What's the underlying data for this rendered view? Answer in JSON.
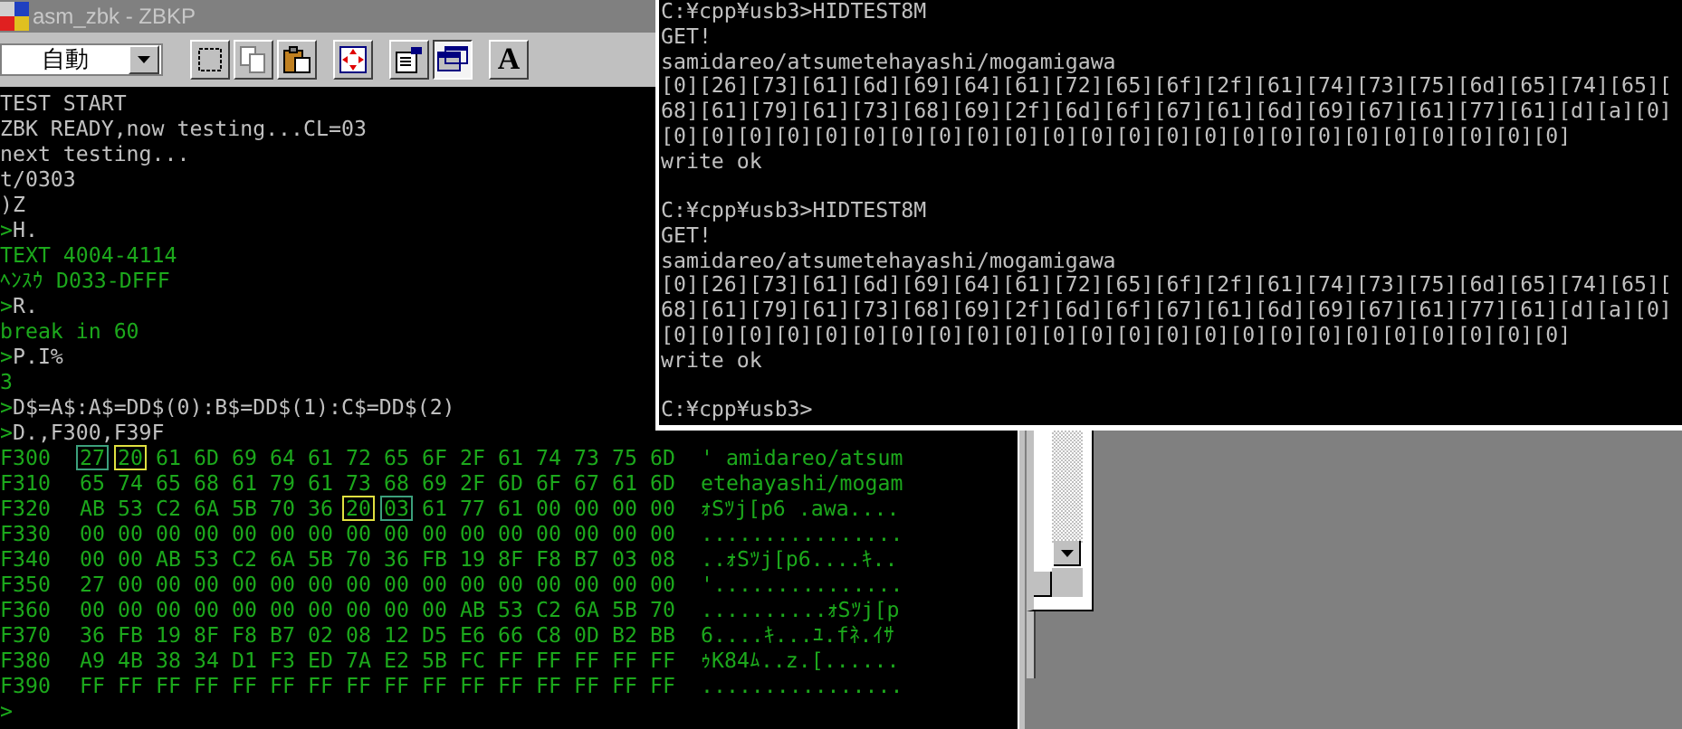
{
  "left_window": {
    "title": "asm_zbk - ZBKP",
    "toolbar": {
      "dropdown": {
        "value": "自動"
      },
      "buttons": [
        {
          "kind": "select",
          "pressed": false
        },
        {
          "kind": "copy",
          "pressed": false
        },
        {
          "kind": "paste",
          "pressed": false
        },
        {
          "kind": "fullscreen",
          "pressed": false
        },
        {
          "kind": "properties",
          "pressed": false
        },
        {
          "kind": "background",
          "pressed": true
        },
        {
          "kind": "font",
          "label": "A",
          "pressed": false
        }
      ]
    },
    "terminal": {
      "lines": [
        {
          "kind": "text",
          "text": "TEST START"
        },
        {
          "kind": "text",
          "text": "ZBK READY,now testing...CL=03"
        },
        {
          "kind": "text",
          "text": "next testing..."
        },
        {
          "kind": "text",
          "text": "t/0303"
        },
        {
          "kind": "text",
          "text": ")Z"
        },
        {
          "kind": "command",
          "prompt": ">",
          "text": "H."
        },
        {
          "kind": "output",
          "text": "TEXT 4004-4114"
        },
        {
          "kind": "output",
          "text": "ﾍﾝｽｳ D033-DFFF"
        },
        {
          "kind": "command",
          "prompt": ">",
          "text": "R."
        },
        {
          "kind": "output",
          "text": "break in 60"
        },
        {
          "kind": "command",
          "prompt": ">",
          "text": "P.I%"
        },
        {
          "kind": "output",
          "text": "3"
        },
        {
          "kind": "command",
          "prompt": ">",
          "text": "D$=A$:A$=DD$(0):B$=DD$(1):C$=DD$(2)"
        },
        {
          "kind": "command",
          "prompt": ">",
          "text": "D.,F300,F39F"
        }
      ],
      "dump": [
        {
          "address": "F300",
          "bytes": [
            {
              "text": "27",
              "color": "#3ca07c"
            },
            {
              "text": "20",
              "color": "#e0e040"
            },
            "61",
            "6D",
            "69",
            "64",
            "61",
            "72",
            "65",
            "6F",
            "2F",
            "61",
            "74",
            "73",
            "75",
            "6D"
          ],
          "ascii": "' amidareo/atsum"
        },
        {
          "address": "F310",
          "bytes": [
            "65",
            "74",
            "65",
            "68",
            "61",
            "79",
            "61",
            "73",
            "68",
            "69",
            "2F",
            "6D",
            "6F",
            "67",
            "61",
            "6D"
          ],
          "ascii": "etehayashi/mogam"
        },
        {
          "address": "F320",
          "bytes": [
            "AB",
            "53",
            "C2",
            "6A",
            "5B",
            "70",
            "36",
            {
              "text": "20",
              "color": "#e0e040"
            },
            {
              "text": "03",
              "color": "#3ca07c"
            },
            "61",
            "77",
            "61",
            "00",
            "00",
            "00",
            "00"
          ],
          "ascii": "ｫSﾂj[p6 .awa...."
        },
        {
          "address": "F330",
          "bytes": [
            "00",
            "00",
            "00",
            "00",
            "00",
            "00",
            "00",
            "00",
            "00",
            "00",
            "00",
            "00",
            "00",
            "00",
            "00",
            "00"
          ],
          "ascii": "................"
        },
        {
          "address": "F340",
          "bytes": [
            "00",
            "00",
            "AB",
            "53",
            "C2",
            "6A",
            "5B",
            "70",
            "36",
            "FB",
            "19",
            "8F",
            "F8",
            "B7",
            "03",
            "08"
          ],
          "ascii": "..ｫSﾂj[p6....ｷ.."
        },
        {
          "address": "F350",
          "bytes": [
            "27",
            "00",
            "00",
            "00",
            "00",
            "00",
            "00",
            "00",
            "00",
            "00",
            "00",
            "00",
            "00",
            "00",
            "00",
            "00"
          ],
          "ascii": "'..............."
        },
        {
          "address": "F360",
          "bytes": [
            "00",
            "00",
            "00",
            "00",
            "00",
            "00",
            "00",
            "00",
            "00",
            "00",
            "AB",
            "53",
            "C2",
            "6A",
            "5B",
            "70"
          ],
          "ascii": "..........ｫSﾂj[p"
        },
        {
          "address": "F370",
          "bytes": [
            "36",
            "FB",
            "19",
            "8F",
            "F8",
            "B7",
            "02",
            "08",
            "12",
            "D5",
            "E6",
            "66",
            "C8",
            "0D",
            "B2",
            "BB"
          ],
          "ascii": "6....ｷ...ﾕ.fﾈ.ｲｻ"
        },
        {
          "address": "F380",
          "bytes": [
            "A9",
            "4B",
            "38",
            "34",
            "D1",
            "F3",
            "ED",
            "7A",
            "E2",
            "5B",
            "FC",
            "FF",
            "FF",
            "FF",
            "FF",
            "FF"
          ],
          "ascii": "ｩK84ﾑ..z.[......"
        },
        {
          "address": "F390",
          "bytes": [
            "FF",
            "FF",
            "FF",
            "FF",
            "FF",
            "FF",
            "FF",
            "FF",
            "FF",
            "FF",
            "FF",
            "FF",
            "FF",
            "FF",
            "FF",
            "FF"
          ],
          "ascii": "................"
        }
      ],
      "prompt": ">"
    }
  },
  "console_window": {
    "blocks": [
      [
        "C:¥cpp¥usb3>HIDTEST8M",
        "GET!",
        "samidareo/atsumetehayashi/mogamigawa",
        "[0][26][73][61][6d][69][64][61][72][65][6f][2f][61][74][73][75][6d][65][74][65][",
        "68][61][79][61][73][68][69][2f][6d][6f][67][61][6d][69][67][61][77][61][d][a][0]",
        "[0][0][0][0][0][0][0][0][0][0][0][0][0][0][0][0][0][0][0][0][0][0][0][0]",
        "write ok"
      ],
      [
        "C:¥cpp¥usb3>HIDTEST8M",
        "GET!",
        "samidareo/atsumetehayashi/mogamigawa",
        "[0][26][73][61][6d][69][64][61][72][65][6f][2f][61][74][73][75][6d][65][74][65][",
        "68][61][79][61][73][68][69][2f][6d][6f][67][61][6d][69][67][61][77][61][d][a][0]",
        "[0][0][0][0][0][0][0][0][0][0][0][0][0][0][0][0][0][0][0][0][0][0][0][0]",
        "write ok"
      ],
      [
        "C:¥cpp¥usb3>"
      ]
    ]
  }
}
